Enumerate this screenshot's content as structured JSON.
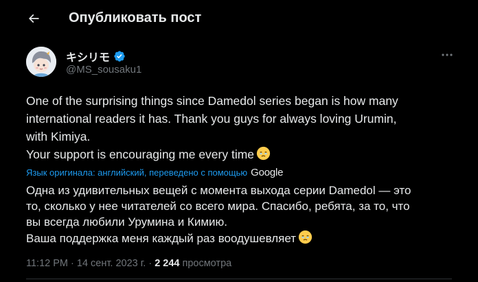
{
  "header": {
    "back_icon": "arrow-left-icon",
    "title": "Опубликовать пост"
  },
  "author": {
    "display_name": "キシリモ",
    "verified_icon": "verified-badge-icon",
    "verified_color": "#1d9bf0",
    "handle": "@MS_sousaku1",
    "more_icon": "more-horizontal-icon"
  },
  "tweet": {
    "lines": [
      "One of the surprising things since Damedol series began is how many",
      "international readers it has. Thank you guys for always loving Urumin,",
      "with Kimiya.",
      "Your support is encouraging me every time"
    ],
    "emoji": "face-holding-back-tears-icon"
  },
  "translation": {
    "note": "Язык оригинала: английский, переведено с помощью",
    "provider": "Google",
    "link_color": "#1d9bf0",
    "lines": [
      "Одна из удивительных вещей с момента выхода серии Damedol — это",
      "то, сколько у нее читателей со всего мира. Спасибо, ребята, за то, что",
      "вы всегда любили Урумина и Кимию.",
      "Ваша поддержка меня каждый раз воодушевляет"
    ]
  },
  "meta": {
    "time": "11:12 PM",
    "separator": " · ",
    "date": "14 сент. 2023 г.",
    "views_count": "2 244",
    "views_label": "просмотра"
  },
  "colors": {
    "background": "#000000",
    "text": "#e7e9ea",
    "muted": "#71767b"
  }
}
